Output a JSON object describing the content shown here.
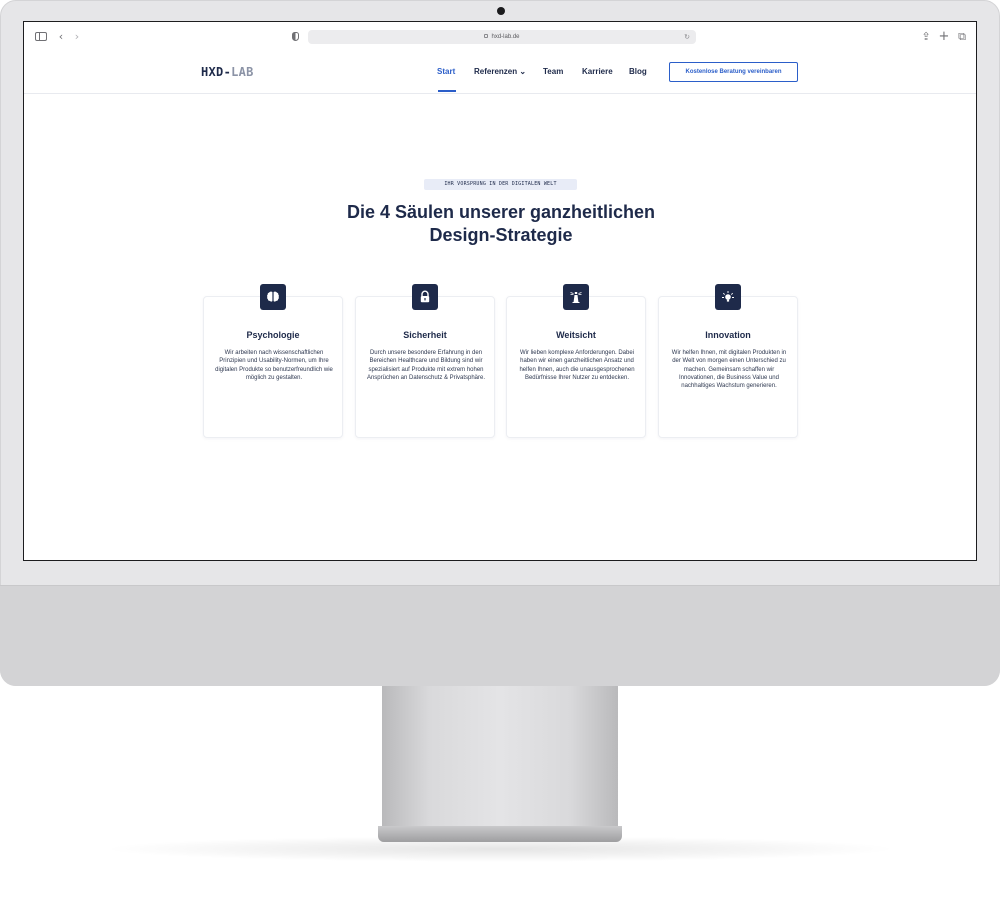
{
  "browser": {
    "url": "hxd-lab.de"
  },
  "site": {
    "logo_main": "HXD-",
    "logo_accent": "LAB",
    "nav": [
      {
        "label": "Start",
        "active": true
      },
      {
        "label": "Referenzen ⌄",
        "active": false
      },
      {
        "label": "Team",
        "active": false
      },
      {
        "label": "Karriere",
        "active": false
      },
      {
        "label": "Blog",
        "active": false
      }
    ],
    "cta_label": "Kostenlose Beratung vereinbaren"
  },
  "hero": {
    "eyebrow": "IHR VORSPRUNG IN DER DIGITALEN WELT",
    "headline_line1": "Die 4 Säulen unserer ganzheitlichen",
    "headline_line2": "Design-Strategie"
  },
  "pillars": [
    {
      "icon": "brain-icon",
      "title": "Psychologie",
      "text": "Wir arbeiten nach wissenschaftlichen Prinzipien und Usability-Normen, um Ihre digitalen Produkte so benutzerfreundlich wie möglich zu gestalten."
    },
    {
      "icon": "lock-icon",
      "title": "Sicherheit",
      "text": "Durch unsere besondere Erfahrung in den Bereichen Healthcare und Bildung sind wir spezialisiert auf Produkte mit extrem hohen Ansprüchen an Datenschutz & Privatsphäre."
    },
    {
      "icon": "lighthouse-icon",
      "title": "Weitsicht",
      "text": "Wir lieben komplexe Anforderungen. Dabei haben wir einen ganzheitlichen Ansatz und helfen Ihnen, auch die unausgesprochenen Bedürfnisse Ihrer Nutzer zu entdecken."
    },
    {
      "icon": "lightbulb-icon",
      "title": "Innovation",
      "text": "Wir helfen Ihnen, mit digitalen Produkten in der Welt von morgen einen Unterschied zu machen. Gemeinsam schaffen wir Innovationen, die Business Value und nachhaltiges Wachstum generieren."
    }
  ],
  "colors": {
    "navy": "#1e2a4a",
    "accent_blue": "#2b5ec9",
    "eyebrow_bg": "#e8ecf7"
  }
}
